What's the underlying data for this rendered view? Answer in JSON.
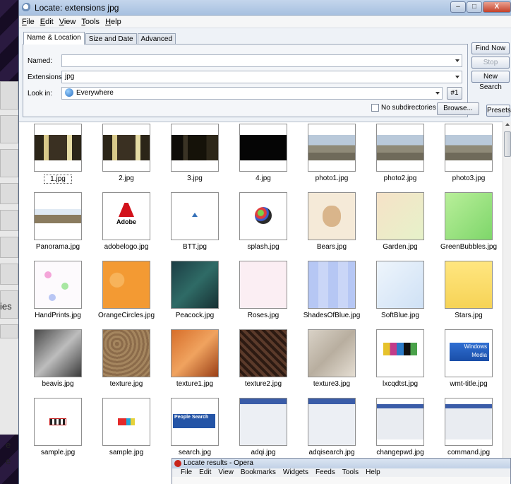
{
  "window": {
    "title": "Locate: extensions jpg",
    "buttons": {
      "min": "–",
      "max": "□",
      "close": "X"
    }
  },
  "menu": [
    "File",
    "Edit",
    "View",
    "Tools",
    "Help"
  ],
  "tabs": [
    "Name & Location",
    "Size and Date",
    "Advanced"
  ],
  "form": {
    "named_label": "Named:",
    "named_value": "",
    "extensions_label": "Extensions:",
    "extensions_value": "jpg",
    "lookin_label": "Look in:",
    "lookin_value": "Everywhere",
    "hash_button": "#1",
    "no_subdirs": "No subdirectories",
    "browse": "Browse..."
  },
  "side_buttons": {
    "find_now": "Find Now",
    "stop": "Stop",
    "new_search": "New Search",
    "presets": "Presets"
  },
  "results": [
    {
      "name": "1.jpg",
      "kind": "room"
    },
    {
      "name": "2.jpg",
      "kind": "room"
    },
    {
      "name": "3.jpg",
      "kind": "dark-room"
    },
    {
      "name": "4.jpg",
      "kind": "black"
    },
    {
      "name": "photo1.jpg",
      "kind": "city"
    },
    {
      "name": "photo2.jpg",
      "kind": "city"
    },
    {
      "name": "photo3.jpg",
      "kind": "city"
    },
    {
      "name": "Panorama.jpg",
      "kind": "panorama"
    },
    {
      "name": "adobelogo.jpg",
      "kind": "adobe"
    },
    {
      "name": "BTT.jpg",
      "kind": "btt"
    },
    {
      "name": "splash.jpg",
      "kind": "splash"
    },
    {
      "name": "Bears.jpg",
      "kind": "bear"
    },
    {
      "name": "Garden.jpg",
      "kind": "garden"
    },
    {
      "name": "GreenBubbles.jpg",
      "kind": "green"
    },
    {
      "name": "HandPrints.jpg",
      "kind": "hands"
    },
    {
      "name": "OrangeCircles.jpg",
      "kind": "orange"
    },
    {
      "name": "Peacock.jpg",
      "kind": "peacock"
    },
    {
      "name": "Roses.jpg",
      "kind": "roses"
    },
    {
      "name": "ShadesOfBlue.jpg",
      "kind": "blues"
    },
    {
      "name": "SoftBlue.jpg",
      "kind": "softblue"
    },
    {
      "name": "Stars.jpg",
      "kind": "stars"
    },
    {
      "name": "beavis.jpg",
      "kind": "beavis"
    },
    {
      "name": "texture.jpg",
      "kind": "texture"
    },
    {
      "name": "texture1.jpg",
      "kind": "texture1"
    },
    {
      "name": "texture2.jpg",
      "kind": "texture2"
    },
    {
      "name": "texture3.jpg",
      "kind": "texture3"
    },
    {
      "name": "lxcqdtst.jpg",
      "kind": "lxcq"
    },
    {
      "name": "wmt-title.jpg",
      "kind": "wmt"
    },
    {
      "name": "sample.jpg",
      "kind": "sample1"
    },
    {
      "name": "sample.jpg",
      "kind": "sample2"
    },
    {
      "name": "search.jpg",
      "kind": "search"
    },
    {
      "name": "adqi.jpg",
      "kind": "dialog"
    },
    {
      "name": "adqisearch.jpg",
      "kind": "dialog"
    },
    {
      "name": "changepwd.jpg",
      "kind": "dialog-small"
    },
    {
      "name": "command.jpg",
      "kind": "dialog-small"
    }
  ],
  "thumb_text": {
    "adobe": "Adobe",
    "windows": "Windows",
    "media": "Media",
    "people": "People",
    "search": "Search"
  },
  "opera": {
    "title": "Locate results - Opera",
    "menu": [
      "File",
      "Edit",
      "View",
      "Bookmarks",
      "Widgets",
      "Feeds",
      "Tools",
      "Help"
    ]
  },
  "background": {
    "fragment_text": "ies",
    "fragment_e1": "e",
    "fragment_e2": "e"
  }
}
